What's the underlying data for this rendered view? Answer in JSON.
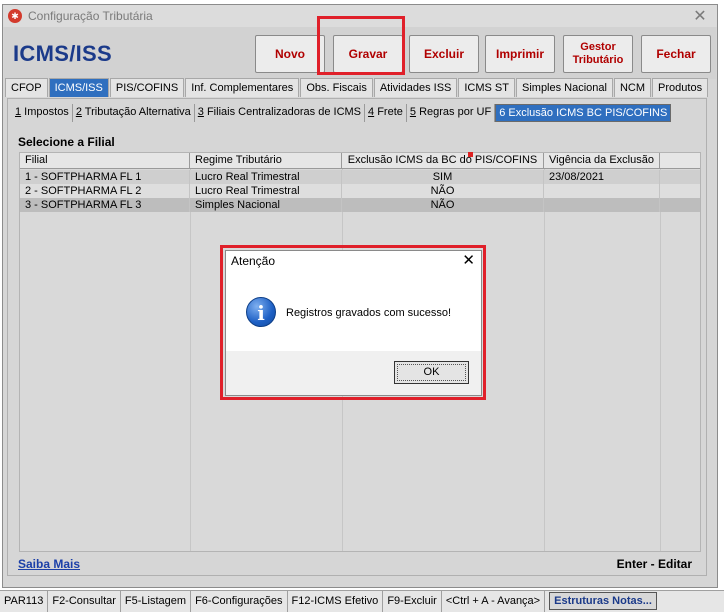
{
  "window": {
    "title": "Configuração Tributária",
    "close_glyph": "✕",
    "icon": "app-logo-icon"
  },
  "header": {
    "module_title": "ICMS/ISS"
  },
  "toolbar": {
    "novo": "Novo",
    "gravar": "Gravar",
    "excluir": "Excluir",
    "imprimir": "Imprimir",
    "gestor": "Gestor Tributário",
    "fechar": "Fechar"
  },
  "main_tabs": [
    "CFOP",
    "ICMS/ISS",
    "PIS/COFINS",
    "Inf. Complementares",
    "Obs. Fiscais",
    "Atividades ISS",
    "ICMS ST",
    "Simples Nacional",
    "NCM",
    "Produtos"
  ],
  "sub_tabs": [
    {
      "key": "1",
      "label": " Impostos"
    },
    {
      "key": "2",
      "label": " Tributação Alternativa"
    },
    {
      "key": "3",
      "label": " Filiais Centralizadoras de ICMS"
    },
    {
      "key": "4",
      "label": " Frete"
    },
    {
      "key": "5",
      "label": " Regras por UF"
    },
    {
      "key": "",
      "label": "6 Exclusão ICMS BC PIS/COFINS"
    }
  ],
  "section_label": "Selecione a Filial",
  "grid": {
    "columns": [
      "Filial",
      "Regime Tributário",
      "Exclusão ICMS da BC do PIS/COFINS",
      "Vigência da Exclusão"
    ],
    "rows": [
      [
        "1 - SOFTPHARMA FL 1",
        "Lucro Real Trimestral",
        "SIM",
        "23/08/2021"
      ],
      [
        "2 - SOFTPHARMA FL 2",
        "Lucro Real Trimestral",
        "NÃO",
        ""
      ],
      [
        "3 - SOFTPHARMA FL 3",
        "Simples Nacional",
        "NÃO",
        ""
      ]
    ]
  },
  "footer": {
    "saiba_mais": "Saiba Mais",
    "enter_editar": "Enter - Editar"
  },
  "statusbar": [
    "PAR113",
    "F2-Consultar",
    "F5-Listagem",
    "F6-Configurações",
    "F12-ICMS Efetivo",
    "F9-Excluir",
    "<Ctrl + A - Avança>",
    "Estruturas Notas..."
  ],
  "dialog": {
    "title": "Atenção",
    "close_glyph": "✕",
    "icon_glyph": "i",
    "message": "Registros gravados com sucesso!",
    "ok": "OK"
  },
  "colors": {
    "accent": "#2f6fbf",
    "button_text": "#b00000",
    "title_blue": "#1b3a8a",
    "highlight": "#e0202a"
  }
}
